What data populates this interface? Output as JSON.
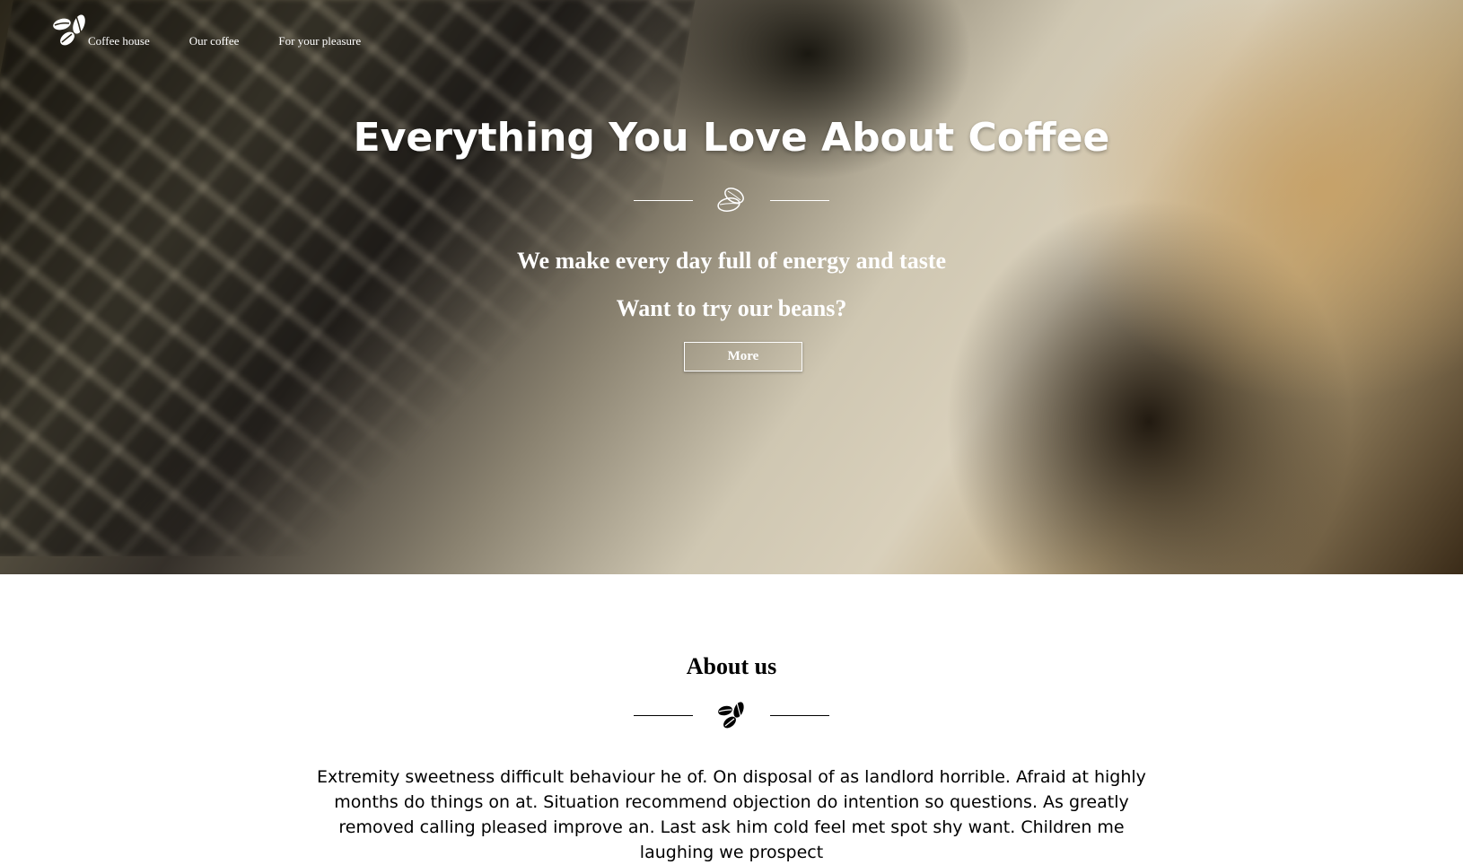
{
  "nav": {
    "items": [
      {
        "label": "Coffee house"
      },
      {
        "label": "Our coffee"
      },
      {
        "label": "For your pleasure"
      }
    ]
  },
  "hero": {
    "title": "Everything You Love About Coffee",
    "subtitle": "We make every day full of energy and taste",
    "question": "Want to try our beans?",
    "button": "More"
  },
  "about": {
    "title": "About us",
    "text": "Extremity sweetness difficult behaviour he of. On disposal of as landlord horrible. Afraid at highly months do things on at. Situation recommend objection do intention so questions. As greatly removed calling pleased improve an. Last ask him cold feel met spot shy want. Children me laughing we prospect"
  },
  "icons": {
    "logo": "coffee-beans-icon",
    "divider": "coffee-bean-icon"
  }
}
